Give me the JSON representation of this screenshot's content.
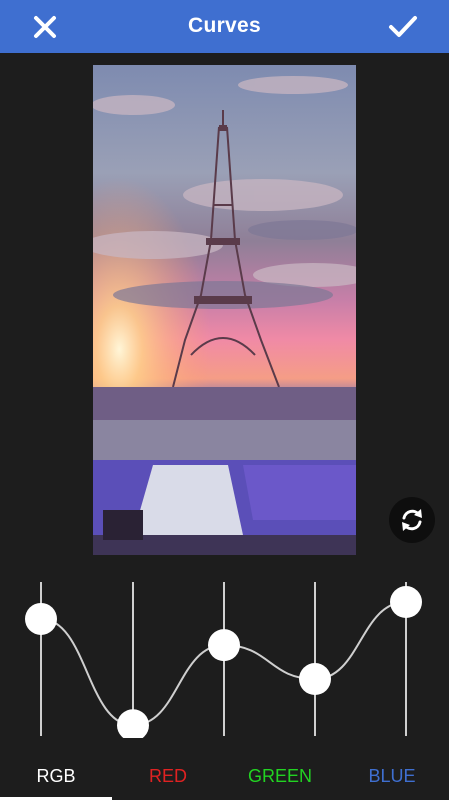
{
  "header": {
    "title": "Curves",
    "close_icon": "close-icon",
    "confirm_icon": "checkmark-icon"
  },
  "colors": {
    "header_bg": "#3f6fd0",
    "background": "#1d1d1d",
    "rgb": "#ffffff",
    "red": "#e02222",
    "green": "#22d322",
    "blue": "#3f6fd0"
  },
  "preview": {
    "subject": "Eiffel Tower at sunset, color-adjusted"
  },
  "reset_button": {
    "icon": "refresh-icon"
  },
  "curve": {
    "points": [
      0.76,
      0.07,
      0.59,
      0.37,
      0.87
    ]
  },
  "channel_tabs": {
    "selected": "RGB",
    "items": [
      {
        "label": "RGB"
      },
      {
        "label": "RED"
      },
      {
        "label": "GREEN"
      },
      {
        "label": "BLUE"
      }
    ]
  }
}
